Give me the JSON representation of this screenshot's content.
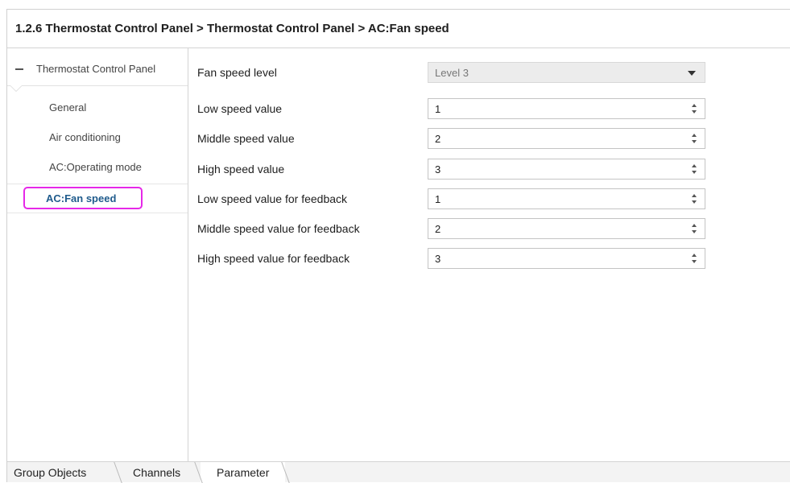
{
  "header": {
    "breadcrumb": "1.2.6 Thermostat Control Panel > Thermostat Control Panel > AC:Fan speed"
  },
  "sidebar": {
    "root_label": "Thermostat Control Panel",
    "items": [
      {
        "label": "General"
      },
      {
        "label": "Air conditioning"
      },
      {
        "label": "AC:Operating mode"
      },
      {
        "label": "AC:Fan speed",
        "selected": true
      }
    ]
  },
  "params": [
    {
      "label": "Fan speed level",
      "value": "Level 3",
      "kind": "dropdown"
    },
    {
      "label": "Low speed value",
      "value": "1",
      "kind": "spinner"
    },
    {
      "label": "Middle speed value",
      "value": "2",
      "kind": "spinner"
    },
    {
      "label": "High speed value",
      "value": "3",
      "kind": "spinner"
    },
    {
      "label": "Low speed value for feedback",
      "value": "1",
      "kind": "spinner"
    },
    {
      "label": "Middle speed value for feedback",
      "value": "2",
      "kind": "spinner"
    },
    {
      "label": "High speed value for feedback",
      "value": "3",
      "kind": "spinner"
    }
  ],
  "tabs": [
    {
      "label": "Group Objects"
    },
    {
      "label": "Channels"
    },
    {
      "label": "Parameter",
      "active": true
    }
  ],
  "colors": {
    "selected_text": "#1f5b8c",
    "highlight_outline": "#e628e8"
  }
}
